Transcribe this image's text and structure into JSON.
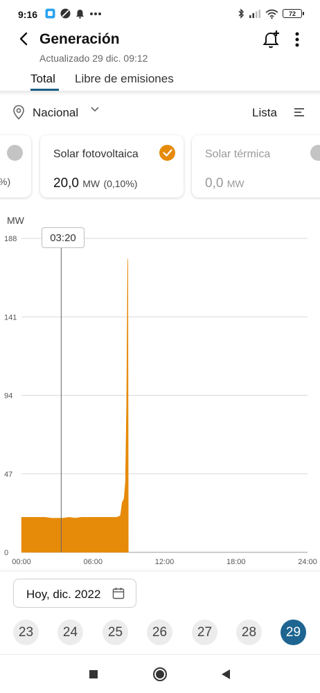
{
  "status_bar": {
    "time": "9:16",
    "battery": "72"
  },
  "header": {
    "title": "Generación",
    "subtitle": "Actualizado 29 dic. 09:12"
  },
  "tabs": [
    {
      "label": "Total",
      "selected": true
    },
    {
      "label": "Libre de emisiones",
      "selected": false
    }
  ],
  "filter": {
    "location": "Nacional",
    "view_label": "Lista"
  },
  "cards": {
    "left": {
      "value_fragment": "%)"
    },
    "main": {
      "name": "Solar fotovoltaica",
      "value": "20,0",
      "unit": "MW",
      "percent": "(0,10%)",
      "selected": true
    },
    "right": {
      "name": "Solar térmica",
      "value": "0,0",
      "unit": "MW",
      "selected": false
    }
  },
  "colors": {
    "accent_orange": "#e68a0a",
    "accent_blue": "#1e6591",
    "tab_underline": "#1a5f86"
  },
  "chart_data": {
    "type": "area",
    "ylabel": "MW",
    "ylim": [
      0,
      188
    ],
    "y_ticks": [
      "0",
      "47",
      "94",
      "141",
      "188"
    ],
    "xlim": [
      0,
      24
    ],
    "x_ticks": [
      "00:00",
      "06:00",
      "12:00",
      "18:00",
      "24:00"
    ],
    "cursor_label": "03:20",
    "cursor_x": 3.333,
    "grid": true,
    "series": [
      {
        "color": "#e68a0a",
        "x": [
          0,
          0.5,
          1,
          1.5,
          2,
          2.5,
          3,
          3.5,
          4,
          4.5,
          5,
          5.5,
          6,
          6.5,
          7,
          7.5,
          8,
          8.3,
          8.45,
          8.6,
          8.72,
          8.82,
          8.9,
          8.93,
          8.97
        ],
        "y": [
          21,
          21,
          21,
          21,
          21,
          20.5,
          20.5,
          20.5,
          21,
          20.5,
          21,
          21,
          21,
          21,
          21,
          21,
          21,
          22,
          30,
          32,
          42,
          90,
          170,
          176,
          0
        ]
      }
    ]
  },
  "date_picker": {
    "label": "Hoy, dic. 2022"
  },
  "days": [
    {
      "label": "23",
      "selected": false
    },
    {
      "label": "24",
      "selected": false
    },
    {
      "label": "25",
      "selected": false
    },
    {
      "label": "26",
      "selected": false
    },
    {
      "label": "27",
      "selected": false
    },
    {
      "label": "28",
      "selected": false
    },
    {
      "label": "29",
      "selected": true
    }
  ]
}
